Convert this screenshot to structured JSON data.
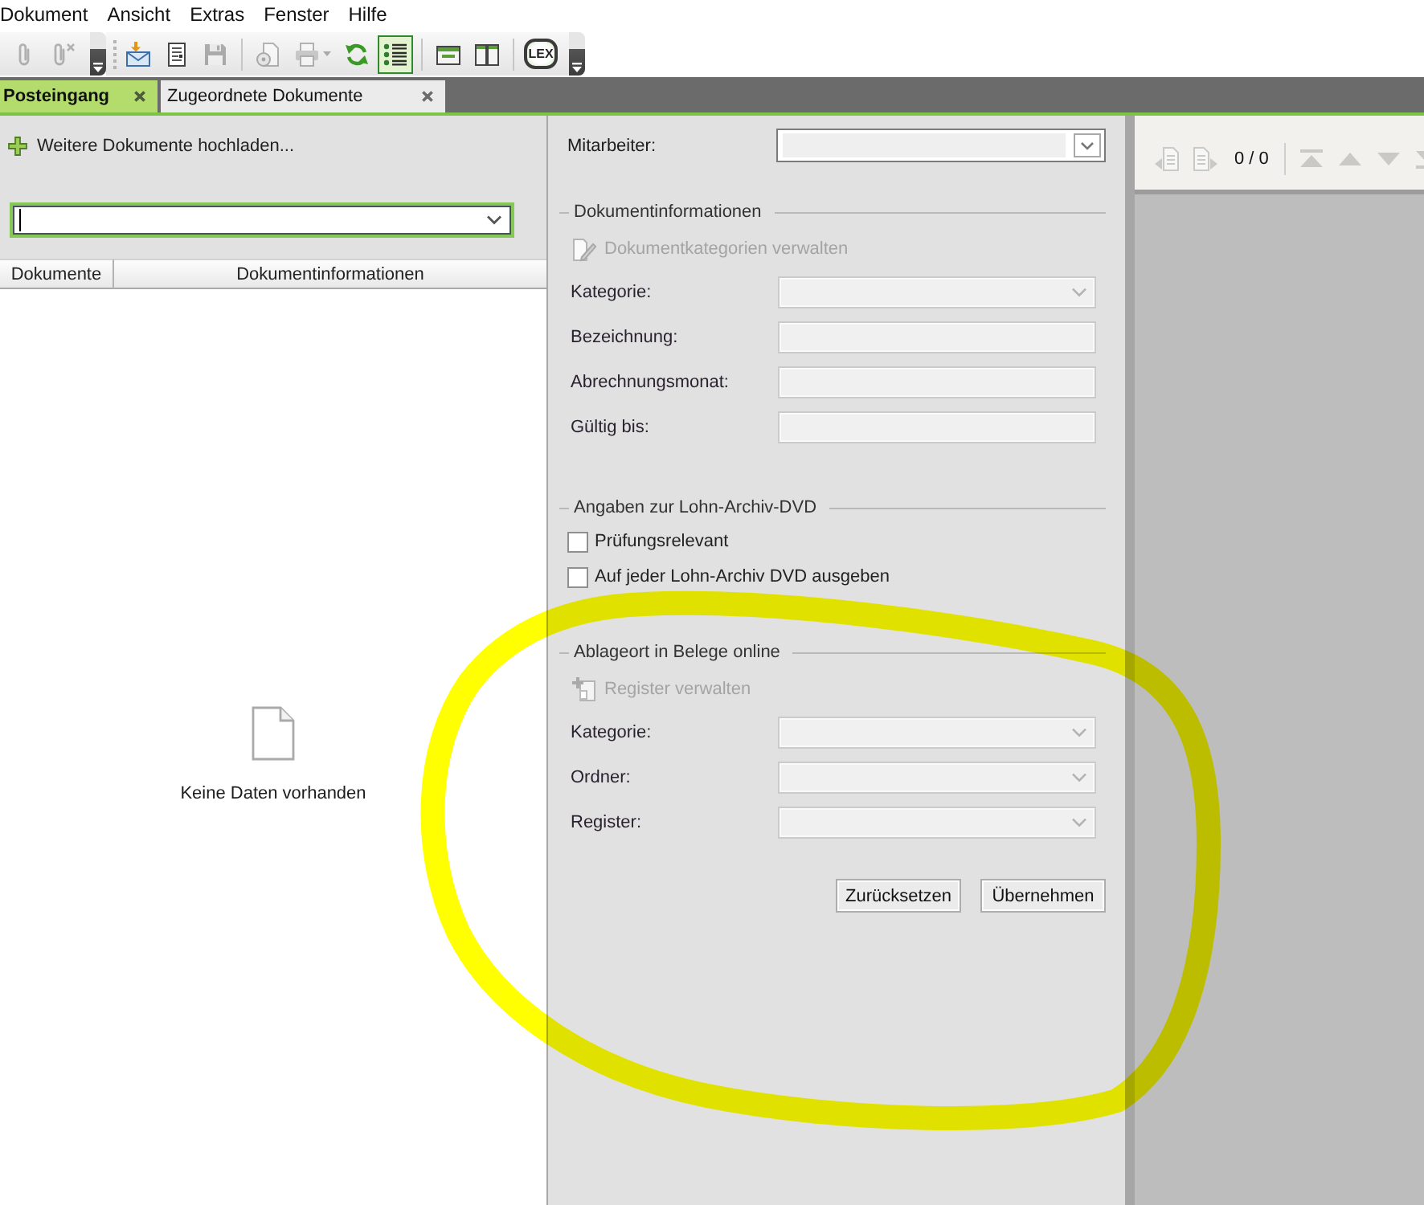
{
  "menu": [
    "Dokument",
    "Ansicht",
    "Extras",
    "Fenster",
    "Hilfe"
  ],
  "toolbars": [
    {
      "groups": [
        [
          {
            "kind": "attach",
            "disabled": true,
            "selected": false
          },
          {
            "kind": "detach",
            "disabled": true,
            "selected": false
          }
        ]
      ]
    },
    {
      "groups": [
        [
          {
            "kind": "mail-import",
            "disabled": false,
            "selected": false
          },
          {
            "kind": "document",
            "disabled": false,
            "selected": false
          },
          {
            "kind": "save",
            "disabled": true,
            "selected": false
          }
        ],
        [
          {
            "kind": "scan",
            "disabled": true,
            "selected": false
          },
          {
            "kind": "print",
            "disabled": true,
            "selected": false
          },
          {
            "kind": "sync",
            "disabled": false,
            "selected": false
          },
          {
            "kind": "list",
            "disabled": false,
            "selected": true
          }
        ],
        [
          {
            "kind": "folder",
            "disabled": false,
            "selected": false
          },
          {
            "kind": "book",
            "disabled": false,
            "selected": false
          }
        ],
        [
          {
            "kind": "lex",
            "label": "LEX",
            "disabled": false,
            "selected": false
          }
        ]
      ]
    }
  ],
  "tabs": [
    {
      "label": "Posteingang",
      "selected": true
    },
    {
      "label": "Zugeordnete Dokumente",
      "selected": false
    }
  ],
  "inbox": {
    "upload_link": "Weitere Dokumente hochladen...",
    "search": {
      "focused": true
    },
    "table": {
      "columns": [
        "Dokumente",
        "Dokumentinformationen"
      ],
      "empty_message": "Keine Daten vorhanden"
    }
  },
  "form": {
    "employee": {
      "label": "Mitarbeiter:",
      "disabled": false
    },
    "sections": [
      {
        "title": "Dokumentinformationen",
        "items": [
          {
            "kind": "action",
            "label": "Dokumentkategorien verwalten",
            "disabled": true
          },
          {
            "kind": "select",
            "label": "Kategorie:",
            "disabled": true
          },
          {
            "kind": "text",
            "label": "Bezeichnung:",
            "disabled": true
          },
          {
            "kind": "text",
            "label": "Abrechnungsmonat:",
            "disabled": true
          },
          {
            "kind": "text",
            "label": "Gültig bis:",
            "disabled": true
          }
        ]
      },
      {
        "title": "Angaben zur Lohn-Archiv-DVD",
        "items": [
          {
            "kind": "checkbox",
            "label": "Prüfungsrelevant",
            "checked": false
          },
          {
            "kind": "checkbox",
            "label": "Auf jeder Lohn-Archiv DVD ausgeben",
            "checked": false
          }
        ]
      },
      {
        "title": "Ablageort in Belege online",
        "items": [
          {
            "kind": "action",
            "label": "Register verwalten",
            "disabled": true
          },
          {
            "kind": "select",
            "label": "Kategorie:",
            "disabled": true
          },
          {
            "kind": "select",
            "label": "Ordner:",
            "disabled": true
          },
          {
            "kind": "select",
            "label": "Register:",
            "disabled": true
          }
        ]
      }
    ],
    "buttons": [
      "Zurücksetzen",
      "Übernehmen"
    ]
  },
  "viewer": {
    "nav": [
      {
        "kind": "previous-document",
        "disabled": true
      },
      {
        "kind": "next-document",
        "disabled": true
      }
    ],
    "counter": "0 / 0",
    "scroll": [
      {
        "kind": "first",
        "disabled": true
      },
      {
        "kind": "up",
        "disabled": true
      },
      {
        "kind": "down",
        "disabled": true
      },
      {
        "kind": "last",
        "disabled": true
      }
    ]
  }
}
